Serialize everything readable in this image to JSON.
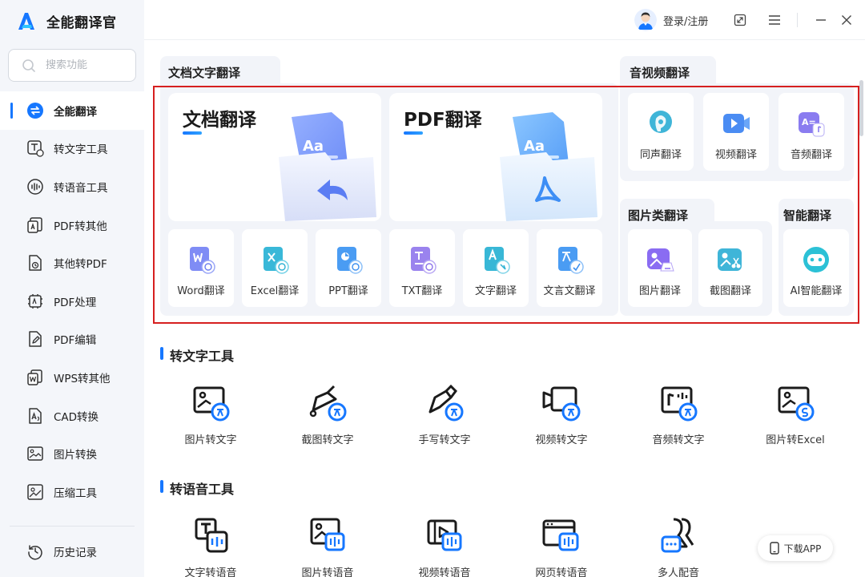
{
  "app": {
    "name": "全能翻译官"
  },
  "search": {
    "placeholder": "搜索功能"
  },
  "sidebar": {
    "items": [
      {
        "label": "全能翻译",
        "icon": "translate-icon"
      },
      {
        "label": "转文字工具",
        "icon": "text-tool-icon"
      },
      {
        "label": "转语音工具",
        "icon": "voice-tool-icon"
      },
      {
        "label": "PDF转其他",
        "icon": "pdf-convert-icon"
      },
      {
        "label": "其他转PDF",
        "icon": "to-pdf-icon"
      },
      {
        "label": "PDF处理",
        "icon": "pdf-process-icon"
      },
      {
        "label": "PDF编辑",
        "icon": "pdf-edit-icon"
      },
      {
        "label": "WPS转其他",
        "icon": "wps-icon"
      },
      {
        "label": "CAD转换",
        "icon": "cad-icon"
      },
      {
        "label": "图片转换",
        "icon": "image-convert-icon"
      },
      {
        "label": "压缩工具",
        "icon": "compress-icon"
      }
    ],
    "active_index": 0,
    "history": {
      "label": "历史记录",
      "icon": "history-icon"
    }
  },
  "topbar": {
    "login_label": "登录/注册"
  },
  "translate": {
    "doc_group": {
      "title": "文档文字翻译",
      "big_cards": [
        {
          "title": "文档翻译"
        },
        {
          "title": "PDF翻译"
        }
      ],
      "small_cards": [
        {
          "label": "Word翻译",
          "icon": "word-icon"
        },
        {
          "label": "Excel翻译",
          "icon": "excel-icon"
        },
        {
          "label": "PPT翻译",
          "icon": "ppt-icon"
        },
        {
          "label": "TXT翻译",
          "icon": "txt-icon"
        },
        {
          "label": "文字翻译",
          "icon": "text-translate-icon"
        },
        {
          "label": "文言文翻译",
          "icon": "classical-chinese-icon"
        }
      ]
    },
    "av_group": {
      "title": "音视频翻译",
      "cards": [
        {
          "label": "同声翻译",
          "icon": "simultaneous-icon"
        },
        {
          "label": "视频翻译",
          "icon": "video-icon"
        },
        {
          "label": "音频翻译",
          "icon": "audio-icon"
        }
      ]
    },
    "image_group": {
      "title": "图片类翻译",
      "cards": [
        {
          "label": "图片翻译",
          "icon": "image-icon"
        },
        {
          "label": "截图翻译",
          "icon": "screenshot-icon"
        }
      ]
    },
    "ai_group": {
      "title": "智能翻译",
      "cards": [
        {
          "label": "AI智能翻译",
          "icon": "ai-robot-icon"
        }
      ]
    }
  },
  "text_tools": {
    "title": "转文字工具",
    "items": [
      {
        "label": "图片转文字"
      },
      {
        "label": "截图转文字"
      },
      {
        "label": "手写转文字"
      },
      {
        "label": "视频转文字"
      },
      {
        "label": "音频转文字"
      },
      {
        "label": "图片转Excel"
      }
    ]
  },
  "voice_tools": {
    "title": "转语音工具",
    "items": [
      {
        "label": "文字转语音"
      },
      {
        "label": "图片转语音"
      },
      {
        "label": "视频转语音"
      },
      {
        "label": "网页转语音"
      },
      {
        "label": "多人配音"
      }
    ]
  },
  "download": {
    "label": "下载APP"
  },
  "colors": {
    "accent": "#1677ff",
    "highlight_frame": "#d61f1f",
    "sidebar_bg": "#f4f6fa",
    "group_bg": "#f2f4f9"
  }
}
